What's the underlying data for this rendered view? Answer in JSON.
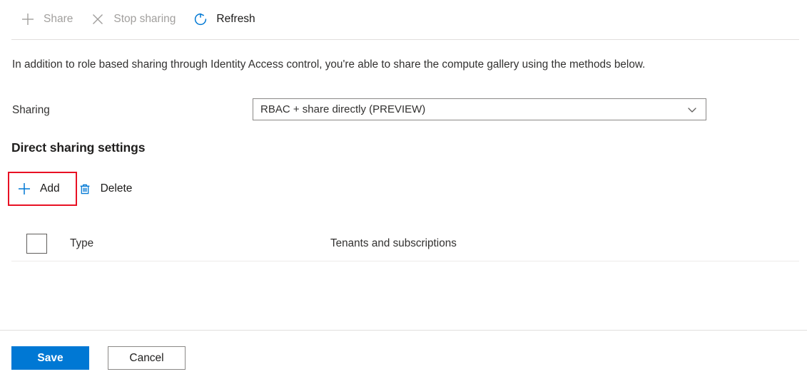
{
  "commandbar": {
    "items": [
      {
        "label": "Share",
        "icon": "plus-icon",
        "enabled": false
      },
      {
        "label": "Stop sharing",
        "icon": "close-icon",
        "enabled": false
      },
      {
        "label": "Refresh",
        "icon": "refresh-icon",
        "enabled": true
      }
    ]
  },
  "description": "In addition to role based sharing through Identity Access control, you're able to share the compute gallery using the methods below.",
  "sharing": {
    "label": "Sharing",
    "selected_value": "RBAC + share directly (PREVIEW)",
    "chevron": "chevron-down-icon"
  },
  "direct_sharing": {
    "heading": "Direct sharing settings",
    "toolbar": [
      {
        "label": "Add",
        "icon": "plus-icon",
        "highlighted": true
      },
      {
        "label": "Delete",
        "icon": "trash-icon",
        "highlighted": false
      }
    ],
    "table": {
      "select_all_checkbox_checked": false,
      "columns": [
        "Type",
        "Tenants and subscriptions"
      ],
      "rows": []
    }
  },
  "footer": {
    "save_label": "Save",
    "cancel_label": "Cancel"
  },
  "colors": {
    "accent_blue": "#0078d4",
    "icon_blue": "#0078d4",
    "disabled_gray": "#a19f9d",
    "highlight_red": "#e81123",
    "text": "#323130",
    "border": "#8a8886",
    "divider": "#e1dfdd"
  }
}
